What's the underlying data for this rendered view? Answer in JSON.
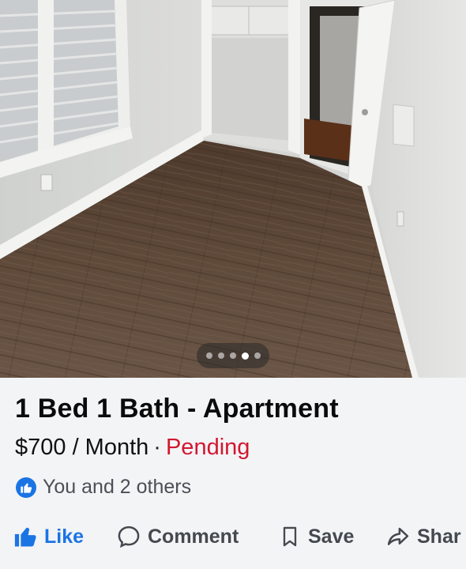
{
  "photo": {
    "alt_context": "",
    "carousel": {
      "total": 5,
      "active_index": 3
    }
  },
  "listing": {
    "title": "1 Bed 1 Bath - Apartment",
    "price": "$700 / Month",
    "separator": "·",
    "status": "Pending",
    "status_color": "#d2172f"
  },
  "reactions": {
    "text": "You and 2 others",
    "icon": "thumbs-up-icon"
  },
  "actions": {
    "like": "Like",
    "comment": "Comment",
    "save": "Save",
    "share": "Shar"
  },
  "colors": {
    "accent": "#1b74e4",
    "background": "#f3f4f6"
  }
}
